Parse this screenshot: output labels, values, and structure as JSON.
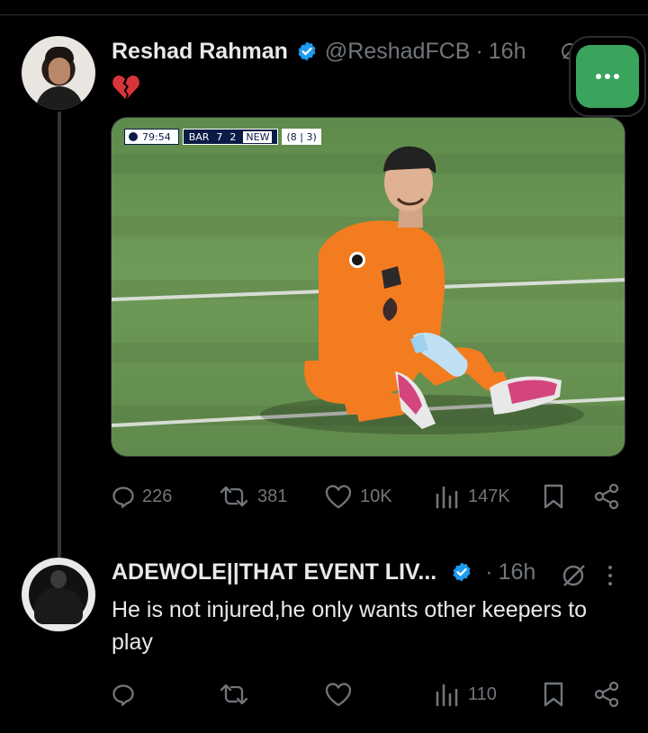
{
  "tweet": {
    "author_name": "Reshad Rahman",
    "handle": "@ReshadFCB",
    "separator": "·",
    "time": "16h",
    "text_emoji": "broken-heart-icon",
    "media": {
      "scorebug": {
        "clock": "79:54",
        "home": "BAR",
        "home_score": "7",
        "away_score": "2",
        "away": "NEW",
        "aggregate": "(8 | 3)"
      }
    },
    "stats": {
      "replies": "226",
      "reposts": "381",
      "likes": "10K",
      "views": "147K"
    }
  },
  "reply": {
    "author_name": "ADEWOLE||THAT EVENT LIV...",
    "separator": "·",
    "time": "16h",
    "text": "He is not injured,he only wants other keepers to play",
    "stats": {
      "views": "110"
    }
  },
  "colors": {
    "background": "#000000",
    "text_primary": "#e7e9ea",
    "text_secondary": "#71767b",
    "verified_blue": "#1d9bf0",
    "heart_red": "#d9343a",
    "floating_button_green": "#3aa35c"
  }
}
